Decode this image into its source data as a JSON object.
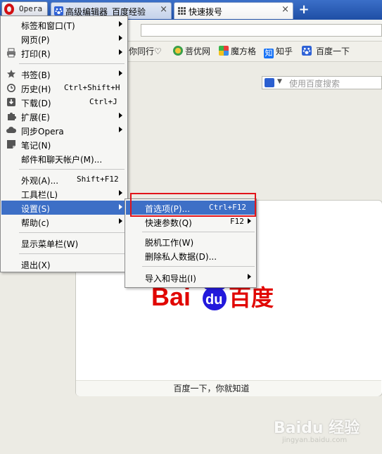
{
  "tabs": {
    "opera_label": "Opera",
    "tab1_title": "高级编辑器_百度经验",
    "tab2_title": "快速拨号",
    "close_glyph": "×",
    "new_tab_glyph": "+"
  },
  "bookmarks": [
    {
      "label": "你同行♡"
    },
    {
      "label": "菩优网"
    },
    {
      "label": "魔方格"
    },
    {
      "label": "知乎",
      "icon_text": "知"
    },
    {
      "label": "百度一下"
    }
  ],
  "search": {
    "placeholder": "使用百度搜索"
  },
  "main_menu": {
    "items": [
      {
        "label": "标签和窗口(T)",
        "shortcut": ""
      },
      {
        "label": "网页(P)",
        "shortcut": ""
      },
      {
        "label": "打印(R)",
        "shortcut": ""
      },
      {
        "label": "书签(B)",
        "shortcut": ""
      },
      {
        "label": "历史(H)",
        "shortcut": "Ctrl+Shift+H"
      },
      {
        "label": "下载(D)",
        "shortcut": "Ctrl+J"
      },
      {
        "label": "扩展(E)",
        "shortcut": ""
      },
      {
        "label": "同步Opera",
        "shortcut": ""
      },
      {
        "label": "笔记(N)",
        "shortcut": ""
      },
      {
        "label": "邮件和聊天帐户(M)...",
        "shortcut": ""
      },
      {
        "label": "外观(A)...",
        "shortcut": "Shift+F12"
      },
      {
        "label": "工具栏(L)",
        "shortcut": ""
      },
      {
        "label": "设置(S)",
        "shortcut": ""
      },
      {
        "label": "帮助(c)",
        "shortcut": ""
      },
      {
        "label": "显示菜单栏(W)",
        "shortcut": ""
      },
      {
        "label": "退出(X)",
        "shortcut": ""
      }
    ]
  },
  "settings_submenu": {
    "items": [
      {
        "label": "首选项(P)...",
        "shortcut": "Ctrl+F12"
      },
      {
        "label": "快速参数(Q)",
        "shortcut": "F12"
      },
      {
        "label": "脱机工作(W)",
        "shortcut": ""
      },
      {
        "label": "删除私人数据(D)...",
        "shortcut": ""
      },
      {
        "label": "导入和导出(I)",
        "shortcut": ""
      }
    ]
  },
  "speed_dial": {
    "logo_text_left": "Bai",
    "logo_text_mid": "du",
    "logo_text_right": "百度",
    "caption": "百度一下，你就知道"
  },
  "watermark": {
    "brand": "Baidu 经验",
    "url": "jingyan.baidu.com"
  },
  "colors": {
    "tab_bar": "#2a5cb8",
    "menu_highlight": "#3d6fc6",
    "annotation_red": "#e2141a",
    "baidu_red": "#e10601",
    "baidu_blue": "#2319dc"
  }
}
